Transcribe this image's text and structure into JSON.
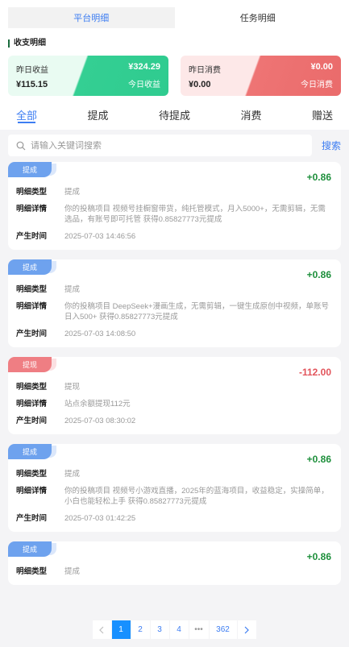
{
  "segment": {
    "active": "平台明细",
    "other": "任务明细"
  },
  "section_title": "收支明细",
  "cards": {
    "income": {
      "yesterday_label": "昨日收益",
      "yesterday_value": "¥324.29",
      "today_value": "¥115.15",
      "today_label": "今日收益"
    },
    "expense": {
      "yesterday_label": "昨日消费",
      "yesterday_value": "¥0.00",
      "today_value": "¥0.00",
      "today_label": "今日消费"
    }
  },
  "tabs": [
    "全部",
    "提成",
    "待提成",
    "消费",
    "赠送"
  ],
  "search": {
    "placeholder": "请输入关键词搜索",
    "button": "搜索"
  },
  "labels": {
    "type": "明细类型",
    "detail": "明细详情",
    "time": "产生时间"
  },
  "records": [
    {
      "tag": "提成",
      "amount": "+0.86",
      "type": "提成",
      "detail": "你的投稿项目 视频号挂橱窗带货，纯托管模式，月入5000+，无需剪辑，无需选品，有账号即可托管 获得0.85827773元提成",
      "time": "2025-07-03 14:46:56"
    },
    {
      "tag": "提成",
      "amount": "+0.86",
      "type": "提成",
      "detail": "你的投稿项目 DeepSeek+漫画生成，无需剪辑，一键生成原创中视频，单账号日入500+ 获得0.85827773元提成",
      "time": "2025-07-03 14:08:50"
    },
    {
      "tag": "提现",
      "amount": "-112.00",
      "type": "提现",
      "detail": "站点余额提现112元",
      "time": "2025-07-03 08:30:02"
    },
    {
      "tag": "提成",
      "amount": "+0.86",
      "type": "提成",
      "detail": "你的投稿项目 视频号小游戏直播，2025年的蓝海项目，收益稳定，实操简单，小白也能轻松上手 获得0.85827773元提成",
      "time": "2025-07-03 01:42:25"
    },
    {
      "tag": "提成",
      "amount": "+0.86",
      "type": "提成",
      "detail": "",
      "time": ""
    }
  ],
  "pagination": {
    "pages": [
      "1",
      "2",
      "3",
      "4"
    ],
    "ellipsis": "•••",
    "last": "362"
  }
}
